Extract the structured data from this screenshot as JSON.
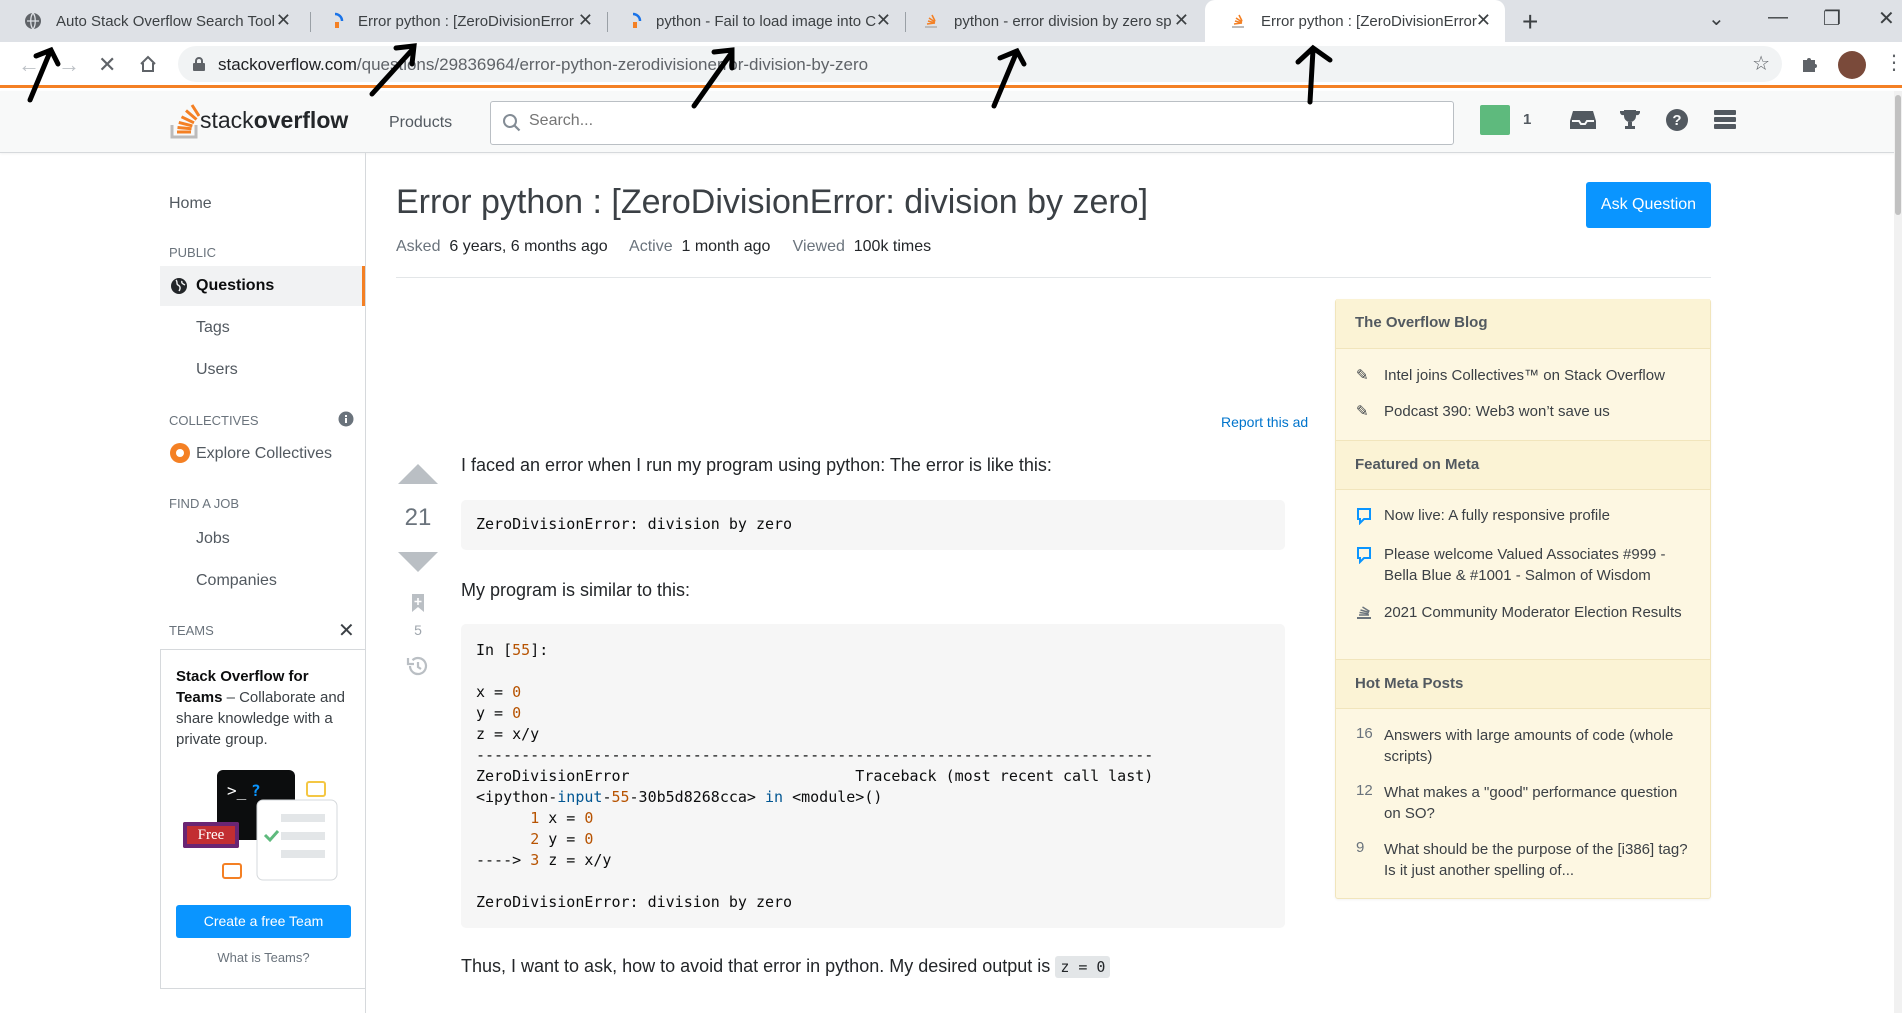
{
  "browser": {
    "tabs": [
      {
        "title": "Auto Stack Overflow Search Tool",
        "active": false
      },
      {
        "title": "Error python : [ZeroDivisionError",
        "active": false
      },
      {
        "title": "python - Fail to load image into C",
        "active": false
      },
      {
        "title": "python - error division by zero sp",
        "active": false
      },
      {
        "title": "Error python : [ZeroDivisionError",
        "active": true
      }
    ],
    "url_domain": "stackoverflow.com",
    "url_path": "/questions/29836964/error-python-zerodivisionerror-division-by-zero"
  },
  "header": {
    "logo_stack": "stack",
    "logo_overflow": "overflow",
    "products": "Products",
    "search_placeholder": "Search...",
    "rep_count": "1"
  },
  "leftnav": {
    "home": "Home",
    "public": "PUBLIC",
    "questions": "Questions",
    "tags": "Tags",
    "users": "Users",
    "collectives": "COLLECTIVES",
    "explore_collectives": "Explore Collectives",
    "find_job": "FIND A JOB",
    "jobs": "Jobs",
    "companies": "Companies",
    "teams": "TEAMS",
    "teams_title": "Stack Overflow for Teams",
    "teams_desc": " – Collaborate and share knowledge with a private group.",
    "free_badge": "Free",
    "create_team": "Create a free Team",
    "what_is_teams": "What is Teams?"
  },
  "question": {
    "title": "Error python : [ZeroDivisionError: division by zero]",
    "ask_button": "Ask Question",
    "asked_label": "Asked",
    "asked_value": "6 years, 6 months ago",
    "active_label": "Active",
    "active_value": "1 month ago",
    "viewed_label": "Viewed",
    "viewed_value": "100k times",
    "report_ad": "Report this ad",
    "votes": "21",
    "bookmarks": "5",
    "body_p1": "I faced an error when I run my program using python: The error is like this:",
    "code1": "ZeroDivisionError: division by zero",
    "body_p2": "My program is similar to this:",
    "code2_in": "In [",
    "code2_in_num": "55",
    "code2_in_end": "]:",
    "code2_x": "x = ",
    "code2_y": "y = ",
    "code2_z": "z = x/y",
    "code2_zero": "0",
    "code2_dashes": "---------------------------------------------------------------------------",
    "code2_err": "ZeroDivisionError                         Traceback (most recent call last)",
    "code2_ipy_a": "<ipython-",
    "code2_ipy_b": "input",
    "code2_ipy_c": "-",
    "code2_ipy_d": "55",
    "code2_ipy_e": "-30b5d8268cca> ",
    "code2_ipy_in": "in",
    "code2_ipy_mod": " <module>()",
    "code2_l1_num": "1",
    "code2_l1": " x = ",
    "code2_l2_num": "2",
    "code2_l2": " y = ",
    "code2_arrow": "----> ",
    "code2_l3_num": "3",
    "code2_l3": " z = x/y",
    "code2_final": "ZeroDivisionError: division by zero",
    "body_p3": "Thus, I want to ask, how to avoid that error in python. My desired output is ",
    "inline_code": "z = 0"
  },
  "sidebar": {
    "blog_title": "The Overflow Blog",
    "blog_items": [
      "Intel joins Collectives™ on Stack Overflow",
      "Podcast 390: Web3 won’t save us"
    ],
    "meta_title": "Featured on Meta",
    "meta_items": [
      "Now live: A fully responsive profile",
      "Please welcome Valued Associates #999 - Bella Blue & #1001 - Salmon of Wisdom",
      "2021 Community Moderator Election Results"
    ],
    "hot_title": "Hot Meta Posts",
    "hot_items": [
      {
        "count": "16",
        "text": "Answers with large amounts of code (whole scripts)"
      },
      {
        "count": "12",
        "text": "What makes a \"good\" performance question on SO?"
      },
      {
        "count": "9",
        "text": "What should be the purpose of the [i386] tag? Is it just another spelling of..."
      }
    ]
  },
  "colors": {
    "accent": "#f48024",
    "blue": "#0a95ff"
  }
}
